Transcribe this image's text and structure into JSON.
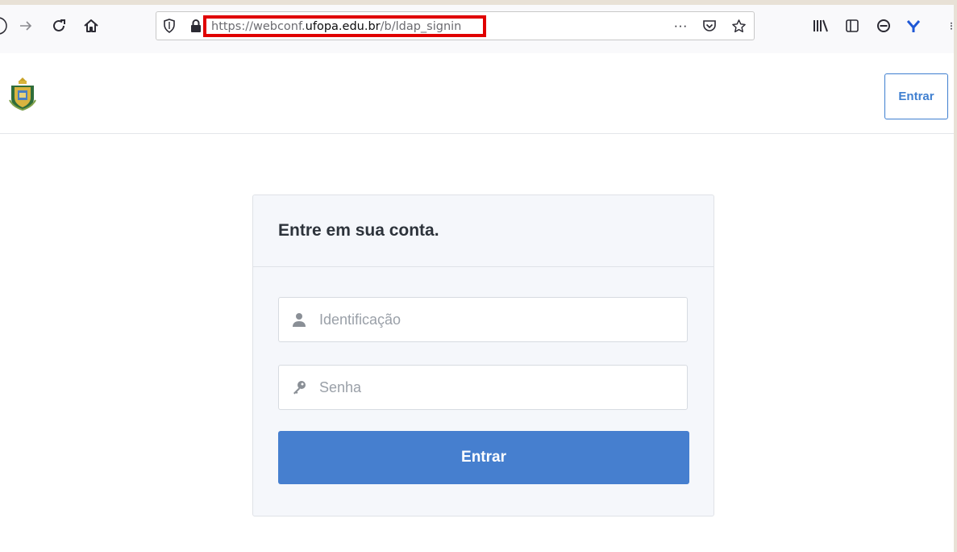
{
  "browser": {
    "url_scheme_path_prefix": "https://webconf.",
    "url_host": "ufopa.edu.br",
    "url_path": "/b/ldap_signin",
    "icons": [
      "back-icon",
      "forward-icon",
      "reload-icon",
      "home-icon",
      "shield-icon",
      "lock-icon",
      "more-icon",
      "pocket-icon",
      "star-icon",
      "library-icon",
      "sidebar-icon",
      "account-icon",
      "extension-icon"
    ],
    "highlight_color": "#e00000"
  },
  "header": {
    "signin_label": "Entrar",
    "logo": "university-crest-logo"
  },
  "login": {
    "title": "Entre em sua conta.",
    "username_placeholder": "Identificação",
    "password_placeholder": "Senha",
    "submit_label": "Entrar"
  },
  "colors": {
    "accent": "#467fcf",
    "card_bg": "#f5f7fb"
  }
}
